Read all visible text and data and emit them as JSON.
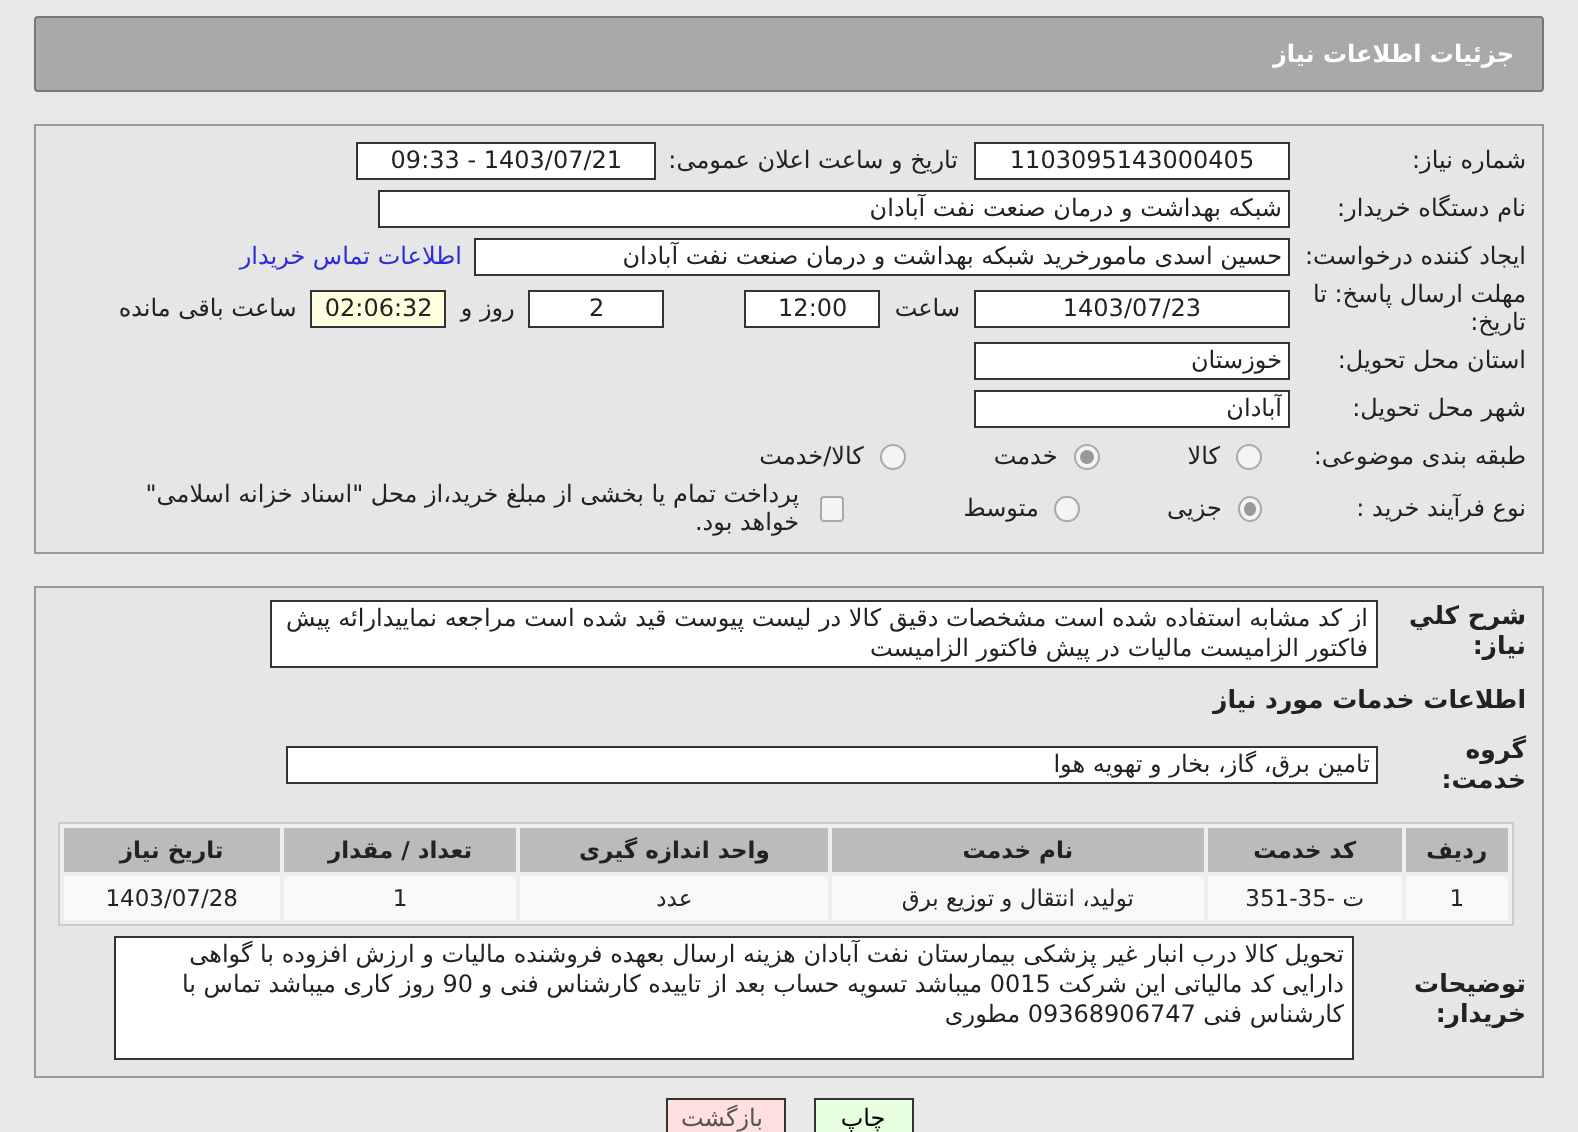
{
  "header": {
    "title": "جزئیات اطلاعات نیاز"
  },
  "need_number": {
    "label": "شماره نیاز:",
    "value": "1103095143000405"
  },
  "announce": {
    "label": "تاریخ و ساعت اعلان عمومی:",
    "value": "1403/07/21 - 09:33"
  },
  "buyer_org": {
    "label": "نام دستگاه خریدار:",
    "value": "شبکه بهداشت و درمان صنعت نفت آبادان"
  },
  "requester": {
    "label": "ایجاد کننده درخواست:",
    "value": "حسین اسدی مامورخرید شبکه بهداشت و درمان صنعت نفت آبادان",
    "link": "اطلاعات تماس خریدار"
  },
  "deadline": {
    "label": "مهلت ارسال پاسخ: تا تاریخ:",
    "date": "1403/07/23",
    "time_label": "ساعت",
    "time": "12:00",
    "days": "2",
    "days_label": "روز و",
    "remaining": "02:06:32",
    "remaining_label": "ساعت باقی مانده"
  },
  "province": {
    "label": "استان محل تحویل:",
    "value": "خوزستان"
  },
  "city": {
    "label": "شهر محل تحویل:",
    "value": "آبادان"
  },
  "category": {
    "label": "طبقه بندی موضوعی:",
    "options": [
      {
        "label": "کالا",
        "selected": false
      },
      {
        "label": "خدمت",
        "selected": true
      },
      {
        "label": "کالا/خدمت",
        "selected": false
      }
    ]
  },
  "process": {
    "label": "نوع فرآیند خرید :",
    "options": [
      {
        "label": "جزیی",
        "selected": true
      },
      {
        "label": "متوسط",
        "selected": false
      }
    ],
    "payment": {
      "checked": false,
      "text": "پرداخت تمام یا بخشی از مبلغ خرید،از محل \"اسناد خزانه اسلامی\" خواهد بود."
    }
  },
  "description": {
    "label": "شرح کلي نياز:",
    "value": "از کد مشابه استفاده شده است مشخصات دقیق کالا در لیست پیوست قید شده است مراجعه نماییدارائه پیش فاکتور الزامیست مالیات در پیش فاکتور الزامیست"
  },
  "services_title": "اطلاعات خدمات مورد نیاز",
  "service_group": {
    "label": "گروه خدمت:",
    "value": "تامین برق، گاز، بخار و تهویه هوا"
  },
  "table": {
    "columns": [
      "ردیف",
      "کد خدمت",
      "نام خدمت",
      "واحد اندازه گیری",
      "تعداد / مقدار",
      "تاریخ نیاز"
    ],
    "rows": [
      [
        "1",
        "ت -35-351",
        "تولید، انتقال و توزیع برق",
        "عدد",
        "1",
        "1403/07/28"
      ]
    ]
  },
  "notes": {
    "label": "توضیحات خریدار:",
    "value": "تحویل کالا درب انبار غیر پزشکی بیمارستان نفت آبادان هزینه ارسال بعهده فروشنده مالیات و ارزش افزوده با گواهی دارایی کد مالیاتی این شرکت 0015 میباشد  تسویه حساب بعد از تاییده کارشناس فنی و 90 روز کاری میباشد تماس با کارشناس فنی 09368906747 مطوری"
  },
  "buttons": {
    "print": "چاپ",
    "back": "بازگشت"
  }
}
